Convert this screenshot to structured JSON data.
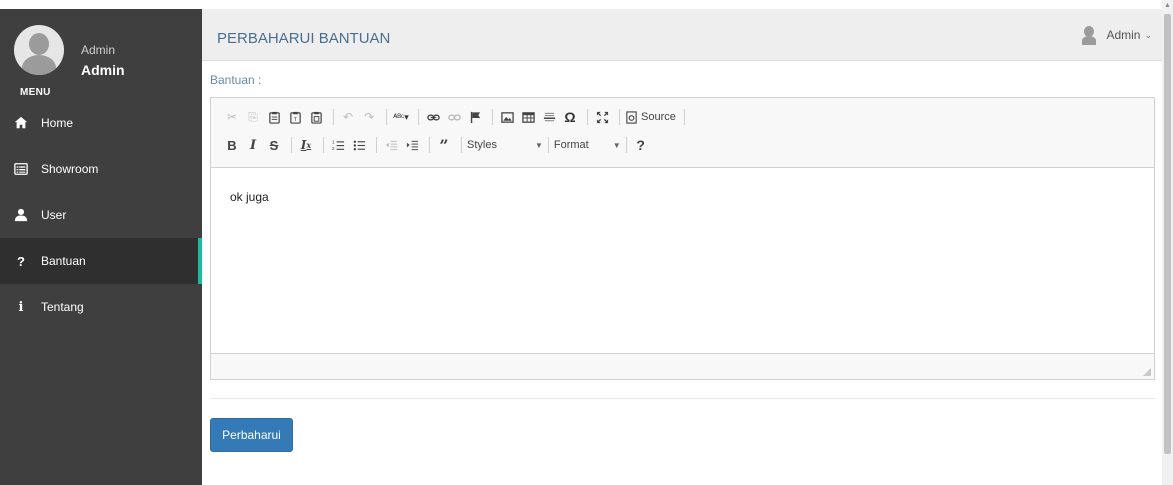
{
  "sidebar": {
    "user_role": "Admin",
    "user_name": "Admin",
    "menu_label": "MENU",
    "items": [
      {
        "label": "Home",
        "icon": "home-icon"
      },
      {
        "label": "Showroom",
        "icon": "list-icon"
      },
      {
        "label": "User",
        "icon": "user-icon"
      },
      {
        "label": "Bantuan",
        "icon": "question-icon",
        "active": true
      },
      {
        "label": "Tentang",
        "icon": "info-icon"
      }
    ],
    "active_color": "#1abc9c"
  },
  "header": {
    "title": "PERBAHARUI BANTUAN",
    "user_label": "Admin",
    "user_chevron": "⌄"
  },
  "form": {
    "field_label": "Bantuan :",
    "editor_content": "ok juga",
    "submit_label": "Perbaharui"
  },
  "toolbar": {
    "source_label": "Source",
    "styles_label": "Styles",
    "format_label": "Format",
    "help_label": "?"
  },
  "colors": {
    "sidebar_bg": "#3f3f3f",
    "accent": "#1abc9c",
    "primary_button": "#337ab7",
    "title_color": "#4a6f90"
  }
}
